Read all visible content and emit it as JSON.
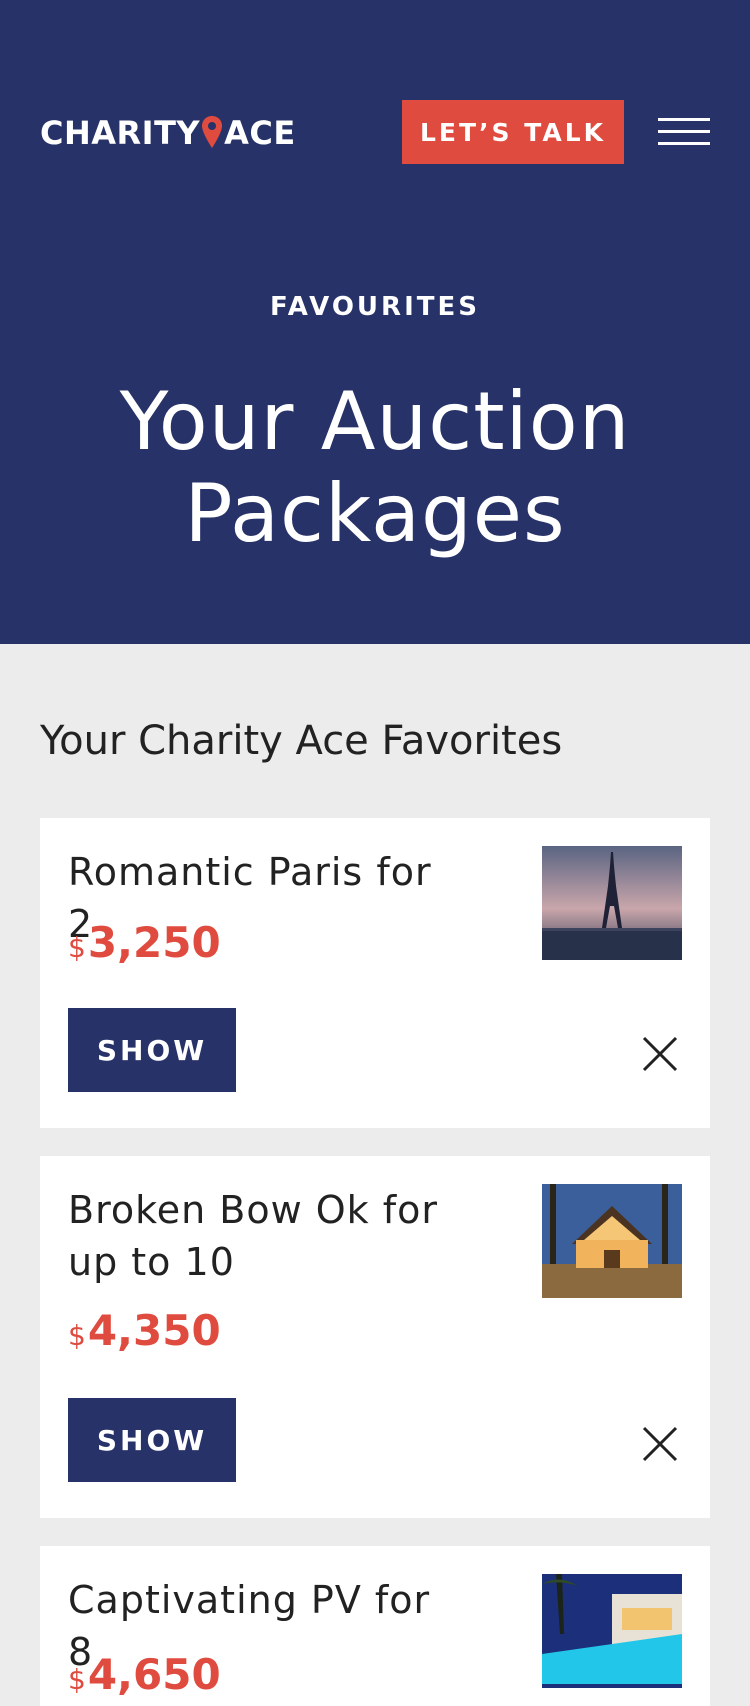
{
  "header": {
    "logo_left": "CHARITY",
    "logo_right": "ACE",
    "cta_label": "LET’S TALK",
    "menu_icon": "hamburger-menu-icon"
  },
  "hero": {
    "eyebrow": "FAVOURITES",
    "title": "Your Auction Packages"
  },
  "favorites": {
    "section_title": "Your Charity Ace Favorites",
    "show_label": "SHOW",
    "remove_icon": "close-icon",
    "currency": "$",
    "items": [
      {
        "title": "Romantic Paris for 2",
        "price": "3,250",
        "image": "eiffel-tower-thumbnail"
      },
      {
        "title": "Broken Bow Ok for up to 10",
        "price": "4,350",
        "image": "log-cabin-thumbnail"
      },
      {
        "title": "Captivating PV for 8",
        "price": "4,650",
        "image": "pool-villa-thumbnail"
      }
    ]
  },
  "colors": {
    "navy": "#273268",
    "accent_red": "#e04b3f",
    "page_bg": "#ebeceb",
    "card_bg": "#ffffff"
  }
}
